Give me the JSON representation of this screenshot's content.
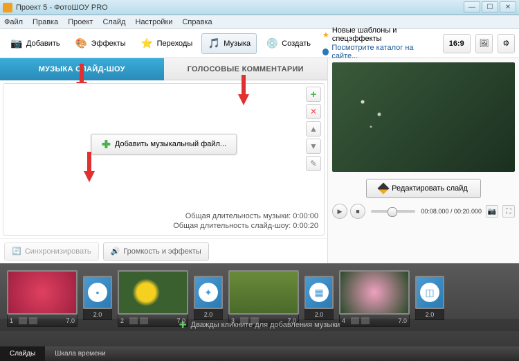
{
  "window": {
    "title": "Проект 5 - ФотоШОУ PRO"
  },
  "menu": {
    "file": "Файл",
    "edit": "Правка",
    "project": "Проект",
    "slide": "Слайд",
    "settings": "Настройки",
    "help": "Справка"
  },
  "toolbar": {
    "add": "Добавить",
    "effects": "Эффекты",
    "transitions": "Переходы",
    "music": "Музыка",
    "create": "Создать",
    "promo1": "Новые шаблоны и спецэффекты",
    "promo2": "Посмотрите каталог на сайте...",
    "ratio": "16:9"
  },
  "tabs": {
    "music": "МУЗЫКА СЛАЙД-ШОУ",
    "voice": "ГОЛОСОВЫЕ КОММЕНТАРИИ"
  },
  "panel": {
    "addMusic": "Добавить музыкальный файл...",
    "dur1": "Общая длительность музыки: 0:00:00",
    "dur2": "Общая длительность слайд-шоу: 0:00:20",
    "sync": "Синхронизировать",
    "volume": "Громкость и эффекты"
  },
  "preview": {
    "edit": "Редактировать слайд",
    "time": "00:08.000 / 00:20.000"
  },
  "timeline": {
    "slides": [
      {
        "n": "1",
        "dur": "7.0"
      },
      {
        "n": "2",
        "dur": "7.0"
      },
      {
        "n": "3",
        "dur": "7.0"
      },
      {
        "n": "4",
        "dur": "7.0"
      }
    ],
    "transDur": "2.0",
    "hint": "Дважды кликните для добавления музыки"
  },
  "footer": {
    "slides": "Слайды",
    "timeline": "Шкала времени"
  },
  "icons": {
    "camera": "📷",
    "palette": "🎨",
    "star": "⭐",
    "notes": "🎵",
    "disc": "💿",
    "gear": "⚙",
    "img": "🖼",
    "speaker": "🔊",
    "sync": "🔄",
    "play": "▶",
    "stop": "■",
    "snap": "📷",
    "full": "⛶"
  }
}
